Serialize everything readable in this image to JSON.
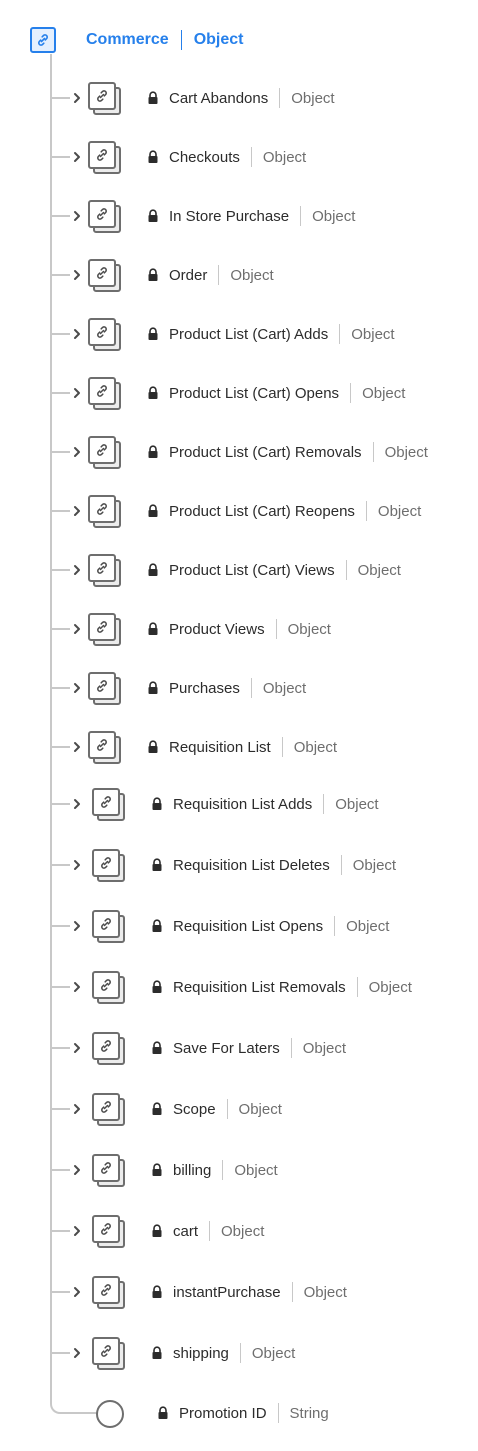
{
  "root": {
    "name": "Commerce",
    "type": "Object",
    "icon": "link-icon"
  },
  "colors": {
    "accent": "#2680eb",
    "line": "#c8c8c8",
    "icon": "#6e6e6e"
  },
  "fields": [
    {
      "name": "Cart Abandons",
      "type": "Object"
    },
    {
      "name": "Checkouts",
      "type": "Object"
    },
    {
      "name": "In Store Purchase",
      "type": "Object"
    },
    {
      "name": "Order",
      "type": "Object"
    },
    {
      "name": "Product List (Cart) Adds",
      "type": "Object"
    },
    {
      "name": "Product List (Cart) Opens",
      "type": "Object"
    },
    {
      "name": "Product List (Cart) Removals",
      "type": "Object"
    },
    {
      "name": "Product List (Cart) Reopens",
      "type": "Object"
    },
    {
      "name": "Product List (Cart) Views",
      "type": "Object"
    },
    {
      "name": "Product Views",
      "type": "Object"
    },
    {
      "name": "Purchases",
      "type": "Object"
    },
    {
      "name": "Requisition List",
      "type": "Object"
    },
    {
      "name": "Requisition List Adds",
      "type": "Object"
    },
    {
      "name": "Requisition List Deletes",
      "type": "Object"
    },
    {
      "name": "Requisition List Opens",
      "type": "Object"
    },
    {
      "name": "Requisition List Removals",
      "type": "Object"
    },
    {
      "name": "Save For Laters",
      "type": "Object"
    },
    {
      "name": "Scope",
      "type": "Object"
    },
    {
      "name": "billing",
      "type": "Object"
    },
    {
      "name": "cart",
      "type": "Object"
    },
    {
      "name": "instantPurchase",
      "type": "Object"
    },
    {
      "name": "shipping",
      "type": "Object"
    }
  ],
  "leaf": {
    "name": "Promotion ID",
    "type": "String"
  }
}
